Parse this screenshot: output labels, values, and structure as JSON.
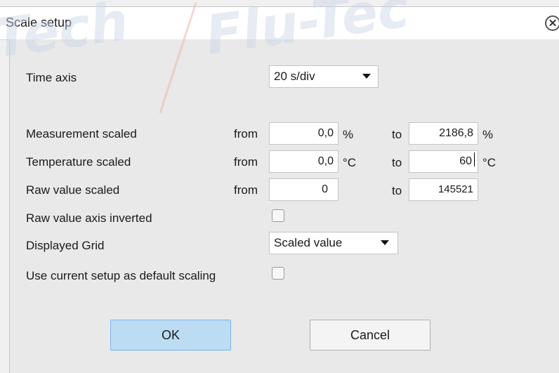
{
  "dialog": {
    "title": "Scale setup",
    "close_icon": "close-icon"
  },
  "watermark": {
    "text_left": "Tech",
    "text_right": "Flu-Tec"
  },
  "time_axis": {
    "label": "Time axis",
    "value": "20 s/div"
  },
  "rows": {
    "measurement": {
      "label": "Measurement scaled",
      "from_label": "from",
      "from_value": "0,0",
      "from_unit": "%",
      "to_label": "to",
      "to_value": "2186,8",
      "to_unit": "%"
    },
    "temperature": {
      "label": "Temperature scaled",
      "from_label": "from",
      "from_value": "0,0",
      "from_unit": "°C",
      "to_label": "to",
      "to_value": "60",
      "to_unit": "°C"
    },
    "raw": {
      "label": "Raw value scaled",
      "from_label": "from",
      "from_value": "0",
      "to_label": "to",
      "to_value": "145521"
    }
  },
  "raw_inverted": {
    "label": "Raw value axis inverted",
    "checked": false
  },
  "displayed_grid": {
    "label": "Displayed Grid",
    "value": "Scaled value"
  },
  "default_scaling": {
    "label": "Use current setup as default scaling",
    "checked": false
  },
  "buttons": {
    "ok": "OK",
    "cancel": "Cancel"
  }
}
